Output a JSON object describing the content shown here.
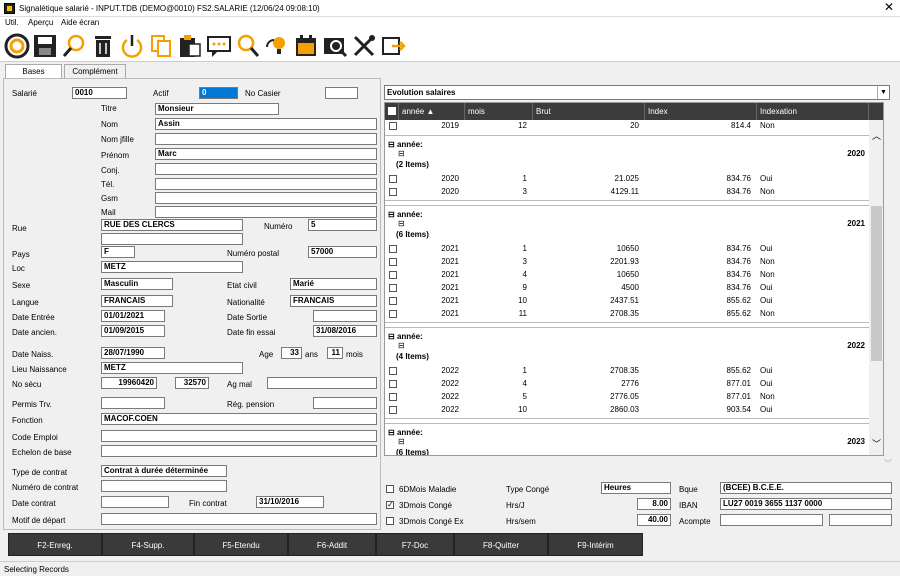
{
  "window": {
    "title": "Signalétique salarié - INPUT.TDB (DEMO@0010) FS2.SALARIE     (12/06/24 09:08:10)",
    "close": "✕"
  },
  "menu": [
    "Util.",
    "Aperçu",
    "Aide écran"
  ],
  "tabs": [
    "Bases",
    "Complément"
  ],
  "labels": {
    "salarie": "Salarié",
    "actif": "Actif",
    "no_casier": "No Casier",
    "titre": "Titre",
    "nom": "Nom",
    "nom_jfille": "Nom jfille",
    "prenom": "Prénom",
    "conj": "Conj.",
    "tel": "Tél.",
    "gsm": "Gsm",
    "mail": "Mail",
    "rue": "Rue",
    "numero": "Numéro",
    "pays": "Pays",
    "numero_postal": "Numéro postal",
    "loc": "Loc",
    "sexe": "Sexe",
    "etat_civil": "Etat civil",
    "langue": "Langue",
    "nationalite": "Nationalité",
    "date_entree": "Date Entrée",
    "date_sortie": "Date Sortie",
    "date_ancien": "Date ancien.",
    "date_fin_essai": "Date fin essai",
    "date_naiss": "Date Naiss.",
    "age": "Age",
    "ans": "ans",
    "mois": "mois",
    "lieu_naissance": "Lieu Naissance",
    "no_secu": "No sécu",
    "ag_mal": "Ag mal",
    "permis_trv": "Permis Trv.",
    "reg_pension": "Rég. pension",
    "fonction": "Fonction",
    "code_emploi": "Code Emploi",
    "echelon": "Echelon de base",
    "type_contrat": "Type de contrat",
    "numero_contrat": "Numéro de contrat",
    "date_contrat": "Date contrat",
    "fin_contrat": "Fin contrat",
    "motif_depart": "Motif de départ"
  },
  "values": {
    "salarie": "0010",
    "actif": "0",
    "no_casier": "",
    "titre": "Monsieur",
    "nom": "Assin",
    "nom_jfille": "",
    "prenom": "Marc",
    "conj": "",
    "tel": "",
    "gsm": "",
    "mail": "",
    "rue": "RUE DES CLERCS",
    "rue2": "",
    "numero": "5",
    "pays": "F",
    "numero_postal": "57000",
    "loc": "METZ",
    "sexe": "Masculin",
    "etat_civil": "Marié",
    "langue": "FRANCAIS",
    "nationalite": "FRANCAIS",
    "date_entree": "01/01/2021",
    "date_sortie": "",
    "date_ancien": "01/09/2015",
    "date_fin_essai": "31/08/2016",
    "date_naiss": "28/07/1990",
    "age_ans": "33",
    "age_mois": "11",
    "lieu_naissance": "METZ",
    "no_secu1": "19960420",
    "no_secu2": "32570",
    "ag_mal": "",
    "permis_trv": "",
    "reg_pension": "",
    "fonction": "MACOF.COEN",
    "code_emploi": "",
    "echelon": "",
    "type_contrat": "Contrat à durée déterminée",
    "numero_contrat": "",
    "date_contrat": "",
    "fin_contrat": "31/10/2016",
    "motif_depart": ""
  },
  "grid": {
    "dropdown": "Evolution salaires",
    "headers": [
      "année",
      "mois",
      "Brut",
      "Index",
      "Indexation"
    ],
    "first_row": {
      "annee": "2019",
      "mois": "12",
      "brut": "20",
      "index": "814.4",
      "indexation": "Non"
    },
    "groups": [
      {
        "label": "année:",
        "year": "2020",
        "count": "(2 Items)",
        "rows": [
          {
            "annee": "2020",
            "mois": "1",
            "brut": "21.025",
            "index": "834.76",
            "indexation": "Oui"
          },
          {
            "annee": "2020",
            "mois": "3",
            "brut": "4129.11",
            "index": "834.76",
            "indexation": "Non"
          }
        ]
      },
      {
        "label": "année:",
        "year": "2021",
        "count": "(6 Items)",
        "rows": [
          {
            "annee": "2021",
            "mois": "1",
            "brut": "10650",
            "index": "834.76",
            "indexation": "Oui"
          },
          {
            "annee": "2021",
            "mois": "3",
            "brut": "2201.93",
            "index": "834.76",
            "indexation": "Non"
          },
          {
            "annee": "2021",
            "mois": "4",
            "brut": "10650",
            "index": "834.76",
            "indexation": "Non"
          },
          {
            "annee": "2021",
            "mois": "9",
            "brut": "4500",
            "index": "834.76",
            "indexation": "Oui"
          },
          {
            "annee": "2021",
            "mois": "10",
            "brut": "2437.51",
            "index": "855.62",
            "indexation": "Oui"
          },
          {
            "annee": "2021",
            "mois": "11",
            "brut": "2708.35",
            "index": "855.62",
            "indexation": "Non"
          }
        ]
      },
      {
        "label": "année:",
        "year": "2022",
        "count": "(4 Items)",
        "rows": [
          {
            "annee": "2022",
            "mois": "1",
            "brut": "2708.35",
            "index": "855.62",
            "indexation": "Oui"
          },
          {
            "annee": "2022",
            "mois": "4",
            "brut": "2776",
            "index": "877.01",
            "indexation": "Oui"
          },
          {
            "annee": "2022",
            "mois": "5",
            "brut": "2776.05",
            "index": "877.01",
            "indexation": "Non"
          },
          {
            "annee": "2022",
            "mois": "10",
            "brut": "2860.03",
            "index": "903.54",
            "indexation": "Oui"
          }
        ]
      },
      {
        "label": "année:",
        "year": "2023",
        "count": "(6 Items)",
        "rows": []
      }
    ]
  },
  "conges": {
    "l6d": "6DMois Maladie",
    "l3d": "3Dmois Congé",
    "l3dex": "3Dmois Congé Ex",
    "type_conge": "Type Congé",
    "type_conge_val": "Heures",
    "hrs_j": "Hrs/J",
    "hrs_j_val": "8.00",
    "hrs_sem": "Hrs/sem",
    "hrs_sem_val": "40.00",
    "bque": "Bque",
    "bque_val": "(BCEE) B.C.E.E.",
    "iban": "IBAN",
    "iban_val": "LU27 0019 3655 1137 0000",
    "acompte": "Acompte",
    "acompte_val": ""
  },
  "buttons": [
    "F2-Enreg.",
    "F4-Supp.",
    "F5-Etendu",
    "F6-Addit",
    "F7-Doc",
    "F8-Quitter",
    "F9-Intérim"
  ],
  "status": "Selecting Records"
}
